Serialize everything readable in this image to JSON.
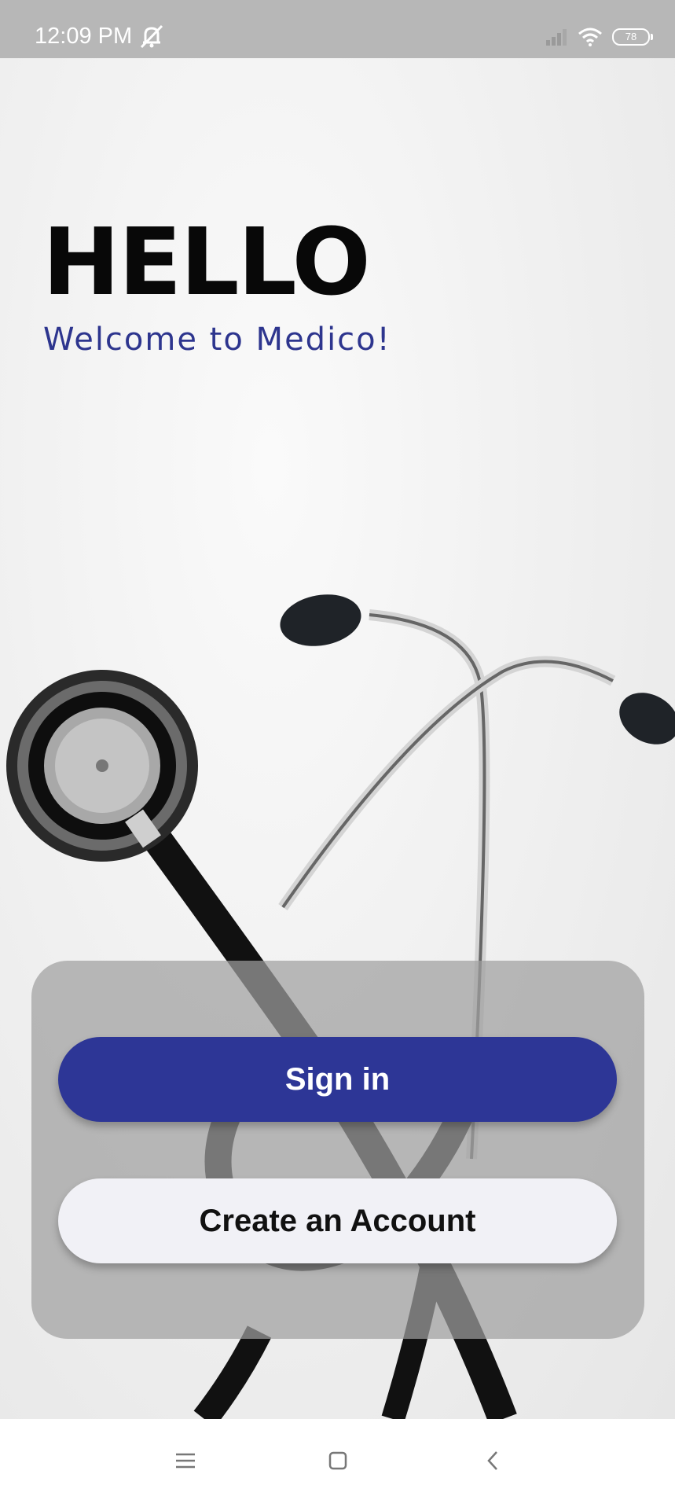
{
  "status_bar": {
    "time": "12:09 PM",
    "battery_level": "78",
    "icons": [
      "muted-bell-icon",
      "signal-icon",
      "wifi-icon",
      "battery-icon"
    ]
  },
  "hero": {
    "title": "HELLO",
    "subtitle": "Welcome to Medico!",
    "background_image": "stethoscope"
  },
  "actions": {
    "sign_in_label": "Sign in",
    "create_account_label": "Create an Account"
  },
  "nav_bar": {
    "icons": [
      "menu-icon",
      "home-icon",
      "back-icon"
    ]
  },
  "colors": {
    "primary": "#2d3696",
    "secondary_button": "#f1f1f6",
    "title": "#080808",
    "subtitle": "#2d358e",
    "status_bar": "#b7b7b7"
  }
}
